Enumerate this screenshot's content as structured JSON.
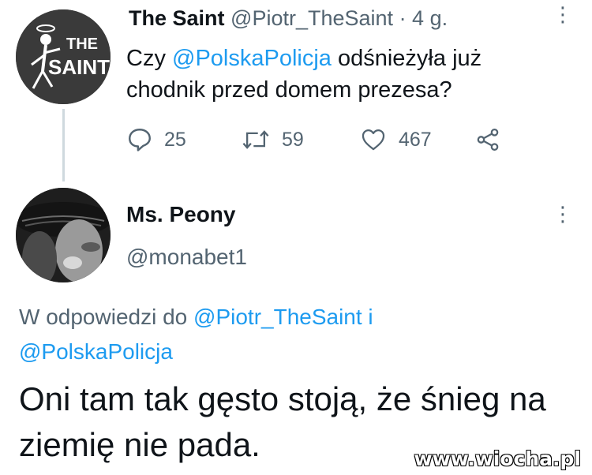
{
  "tweet": {
    "author_name": "The Saint",
    "author_handle": "@Piotr_TheSaint",
    "time": "· 4 g.",
    "text_before": "Czy ",
    "mention": "@PolskaPolicja",
    "text_after": " odśnieżyła już chodnik przed domem prezesa?",
    "avatar_text_top": "THE",
    "avatar_text_bottom": "SAINT",
    "replies": "25",
    "retweets": "59",
    "likes": "467",
    "menu_icon": "⋮"
  },
  "reply": {
    "author_name": "Ms. Peony",
    "author_handle": "@monabet1",
    "replying_prefix": "W odpowiedzi do ",
    "replying_to_1": "@Piotr_TheSaint",
    "replying_conj": " i",
    "replying_to_2": "@PolskaPolicja",
    "text": "Oni tam tak gęsto stoją, że śnieg na ziemię nie pada.",
    "menu_icon": "⋮"
  },
  "watermark": "www.wiocha.pl",
  "icons": {
    "reply": "speech-bubble-icon",
    "retweet": "retweet-icon",
    "like": "heart-icon",
    "share": "share-icon"
  },
  "colors": {
    "link": "#1d9bf0",
    "secondary": "#536471",
    "text": "#0f1419"
  }
}
